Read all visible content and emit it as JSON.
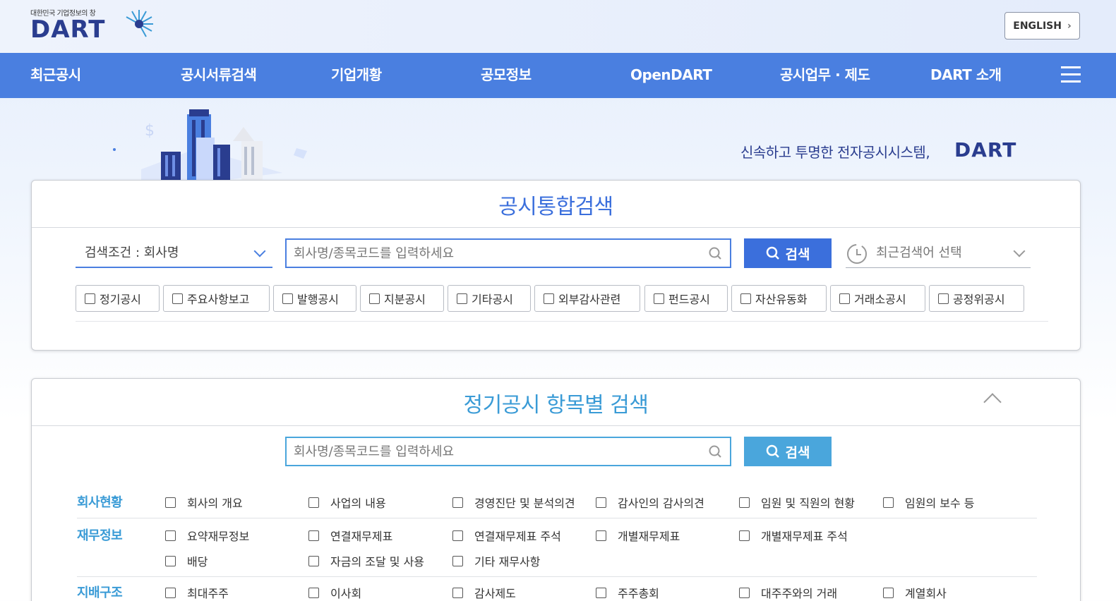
{
  "header": {
    "logo_sub": "대한민국 기업정보의 창",
    "logo_main": "DART",
    "lang_button": "ENGLISH"
  },
  "nav": {
    "items": [
      "최근공시",
      "공시서류검색",
      "기업개황",
      "공모정보",
      "OpenDART",
      "공시업무 · 제도",
      "DART 소개"
    ]
  },
  "banner": {
    "slogan": "신속하고 투명한 전자공시시스템,",
    "slogan_brand": "DART"
  },
  "integrated_search": {
    "title": "공시통합검색",
    "condition_label": "검색조건 : 회사명",
    "input_placeholder": "회사명/종목코드를 입력하세요",
    "search_button": "검색",
    "recent_label": "최근검색어 선택",
    "filters": [
      "정기공시",
      "주요사항보고",
      "발행공시",
      "지분공시",
      "기타공시",
      "외부감사관련",
      "펀드공시",
      "자산유동화",
      "거래소공시",
      "공정위공시"
    ]
  },
  "item_search": {
    "title": "정기공시 항목별 검색",
    "input_placeholder": "회사명/종목코드를 입력하세요",
    "search_button": "검색",
    "categories": [
      {
        "name": "회사현황",
        "items": [
          "회사의 개요",
          "사업의 내용",
          "경영진단 및 분석의견",
          "감사인의 감사의견",
          "임원 및 직원의 현황",
          "임원의 보수 등"
        ]
      },
      {
        "name": "재무정보",
        "items": [
          "요약재무정보",
          "연결재무제표",
          "연결재무제표 주석",
          "개별재무제표",
          "개별재무제표 주석",
          "배당",
          "자금의 조달 및 사용",
          "기타 재무사항"
        ]
      },
      {
        "name": "지배구조",
        "items": [
          "최대주주",
          "이사회",
          "감사제도",
          "주주총회",
          "대주주와의 거래",
          "계열회사"
        ]
      }
    ]
  },
  "colors": {
    "nav_bg": "#4a7fe0",
    "brand_navy": "#2a3d8f",
    "accent_blue": "#3a9bd6",
    "search_btn_1": "#3b6fdc",
    "search_btn_2": "#4aa6dc"
  }
}
